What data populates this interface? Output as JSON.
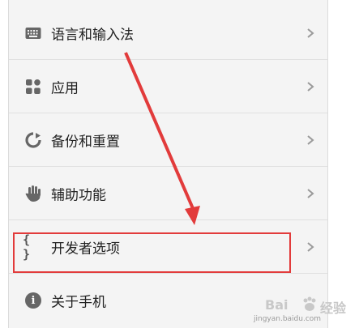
{
  "settings": {
    "items": [
      {
        "label": "语言和输入法",
        "icon": "keyboard-icon"
      },
      {
        "label": "应用",
        "icon": "apps-grid-icon"
      },
      {
        "label": "备份和重置",
        "icon": "backup-reset-icon"
      },
      {
        "label": "辅助功能",
        "icon": "hand-icon"
      },
      {
        "label": "开发者选项",
        "icon": "braces-icon",
        "icon_text": "{ }"
      },
      {
        "label": "关于手机",
        "icon": "info-icon",
        "icon_text": "i"
      }
    ]
  },
  "annotation": {
    "color": "#e23b3b"
  },
  "watermark": {
    "main_left": "Bai",
    "main_right": "经验",
    "sub": "jingyan.baidu.com"
  }
}
